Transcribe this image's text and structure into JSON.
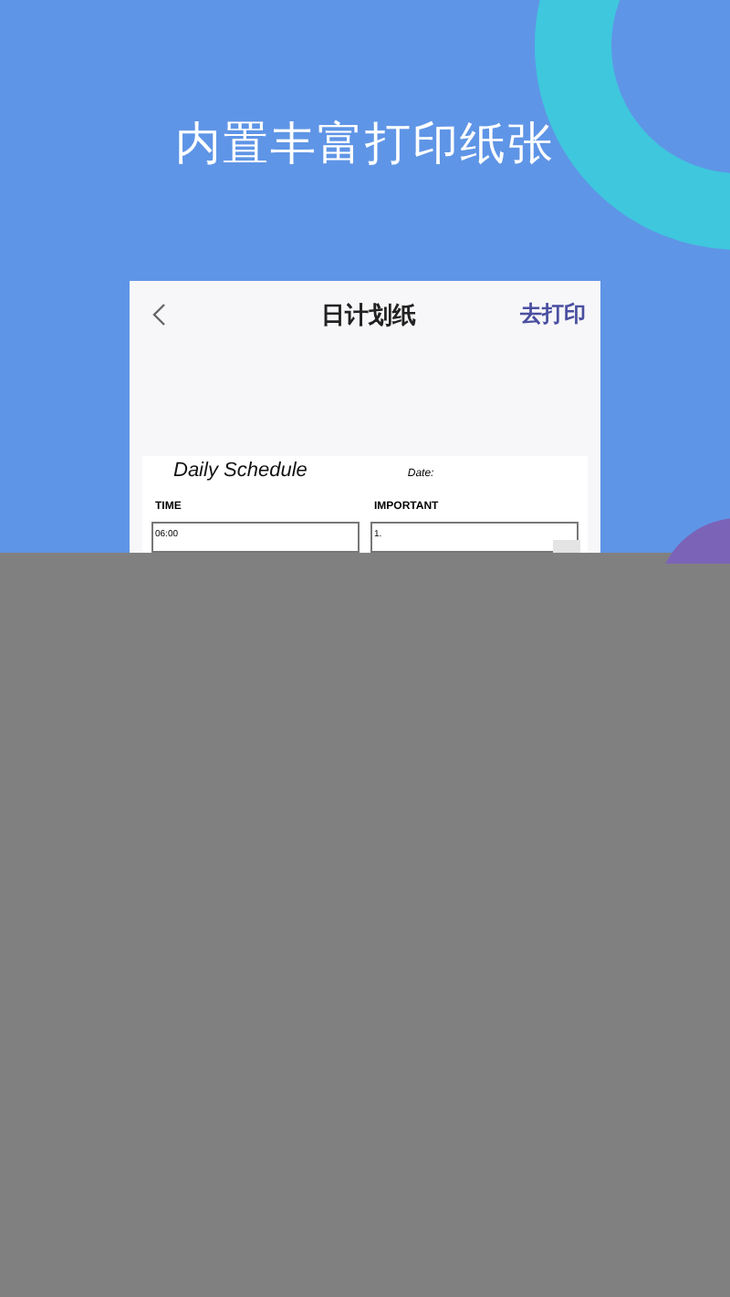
{
  "headline": "内置丰富打印纸张",
  "screen": {
    "title": "日计划纸",
    "action": "去打印"
  },
  "sheet": {
    "title": "Daily Schedule",
    "date_label": "Date:",
    "columns": [
      {
        "heading": "TIME",
        "first_entry": "06:00"
      },
      {
        "heading": "IMPORTANT",
        "first_entry": "1."
      }
    ]
  }
}
